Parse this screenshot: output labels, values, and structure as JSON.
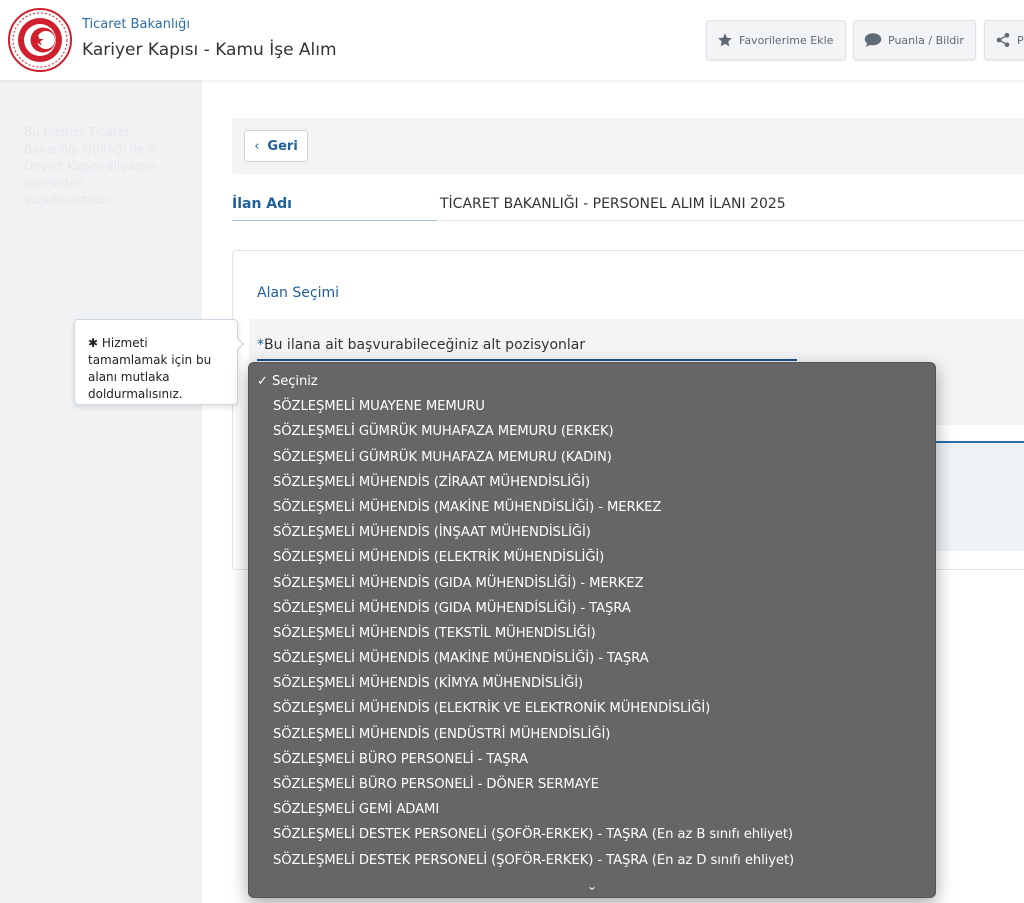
{
  "header": {
    "org_name": "Ticaret Bakanlığı",
    "app_title": "Kariyer Kapısı - Kamu İşe Alım",
    "buttons": {
      "favorites": "Favorilerime Ekle",
      "rate": "Puanla / Bildir",
      "share": "P"
    }
  },
  "sidebar": {
    "note": "Bu hizmet Ticaret Bakanlığı işbirliği ile e-Devlet Kapısı altyapısı üzerinden sunulmaktadır."
  },
  "main": {
    "back_label": "Geri",
    "ilan_label": "İlan Adı",
    "ilan_value": "TİCARET BAKANLIĞI - PERSONEL ALIM İLANI 2025",
    "section_title": "Alan Seçimi",
    "field_required_mark": "*",
    "field_label": "Bu ilana ait başvurabileceğiniz alt pozisyonlar"
  },
  "tooltip": {
    "star": "✱",
    "text": "Hizmeti tamamlamak için bu alanı mutlaka doldurmalısınız."
  },
  "dropdown": {
    "selected_check": "✓",
    "selected_label": "Seçiniz",
    "options": [
      "SÖZLEŞMELİ MUAYENE MEMURU",
      "SÖZLEŞMELİ GÜMRÜK MUHAFAZA MEMURU (ERKEK)",
      "SÖZLEŞMELİ GÜMRÜK MUHAFAZA MEMURU (KADIN)",
      "SÖZLEŞMELİ MÜHENDİS (ZİRAAT MÜHENDİSLİĞİ)",
      "SÖZLEŞMELİ MÜHENDİS (MAKİNE MÜHENDİSLİĞİ) - MERKEZ",
      "SÖZLEŞMELİ MÜHENDİS (İNŞAAT MÜHENDİSLİĞİ)",
      "SÖZLEŞMELİ MÜHENDİS (ELEKTRİK MÜHENDİSLİĞİ)",
      "SÖZLEŞMELİ MÜHENDİS (GIDA MÜHENDİSLİĞİ) - MERKEZ",
      "SÖZLEŞMELİ MÜHENDİS (GIDA MÜHENDİSLİĞİ) - TAŞRA",
      "SÖZLEŞMELİ MÜHENDİS (TEKSTİL MÜHENDİSLİĞİ)",
      "SÖZLEŞMELİ MÜHENDİS (MAKİNE MÜHENDİSLİĞİ) - TAŞRA",
      "SÖZLEŞMELİ MÜHENDİS (KİMYA MÜHENDİSLİĞİ)",
      "SÖZLEŞMELİ MÜHENDİS (ELEKTRİK VE ELEKTRONİK MÜHENDİSLİĞİ)",
      "SÖZLEŞMELİ MÜHENDİS (ENDÜSTRİ MÜHENDİSLİĞİ)",
      "SÖZLEŞMELİ BÜRO PERSONELİ - TAŞRA",
      "SÖZLEŞMELİ BÜRO PERSONELİ - DÖNER SERMAYE",
      "SÖZLEŞMELİ GEMİ ADAMI",
      "SÖZLEŞMELİ DESTEK PERSONELİ (ŞOFÖR-ERKEK) - TAŞRA (En az B sınıfı ehliyet)",
      "SÖZLEŞMELİ DESTEK PERSONELİ (ŞOFÖR-ERKEK) - TAŞRA (En az D sınıfı ehliyet)"
    ],
    "more_icon": "chevron-down-icon"
  },
  "colors": {
    "brand_blue": "#2d6ea5",
    "logo_red": "#d0202e",
    "dropdown_bg": "#666666"
  }
}
